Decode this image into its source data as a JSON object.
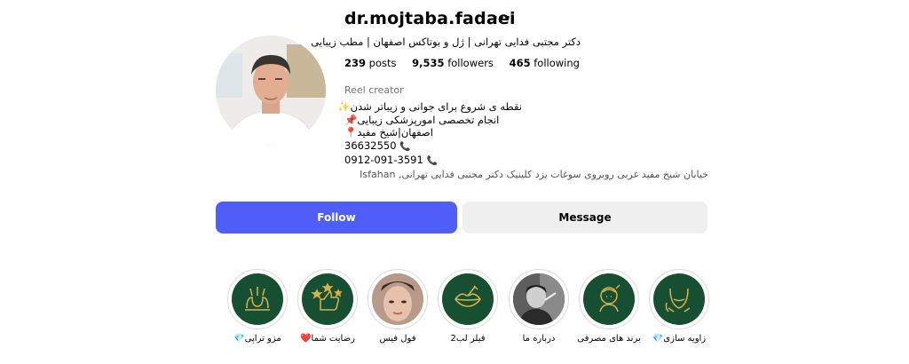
{
  "profile": {
    "username": "dr.mojtaba.fadaei",
    "more_label": "···",
    "full_name": "دکتر مجتبی فدایی تهرانی | ژل و بوتاکس اصفهان | مطب زیبایی",
    "stats": {
      "posts_count": "239",
      "posts_label": "posts",
      "followers_count": "9,535",
      "followers_label": "followers",
      "following_count": "465",
      "following_label": "following"
    },
    "category": "Reel creator",
    "bio": {
      "line1": "نقطه ی شروع برای جوانی و زیباتر شدن✨",
      "line2": "انجام تخصصی امورپزشکی زیبایی📌",
      "line3": "اصفهان|شیخ مفید📍",
      "phone1": "36632550",
      "phone2": "0912-091-3591",
      "phone_icon": "📞"
    },
    "address": "خیابان شیخ مفید غربی روبروی سوغات یزد کلینیک دکتر مجتبی فدایی تهرانی, Isfahan"
  },
  "buttons": {
    "follow": "Follow",
    "message": "Message"
  },
  "highlights": [
    {
      "label": "زاویه سازی💎",
      "icon": "jawline-icon"
    },
    {
      "label": "برند های مصرفی",
      "icon": "skincare-brands-icon"
    },
    {
      "label": "درباره ما",
      "icon": "about-us-photo"
    },
    {
      "label": "فیلر لب2",
      "icon": "lips-icon"
    },
    {
      "label": "فول فیس",
      "icon": "full-face-photo"
    },
    {
      "label": "رضایت شما❤️",
      "icon": "thumbs-up-stars-icon"
    },
    {
      "label": "مزو تراپی💎",
      "icon": "hair-mesotherapy-icon"
    }
  ],
  "colors": {
    "follow_button": "#4f5ef7",
    "message_button": "#efefef",
    "highlight_bg": "#174f33",
    "icon_gold": "#d8b24a"
  }
}
